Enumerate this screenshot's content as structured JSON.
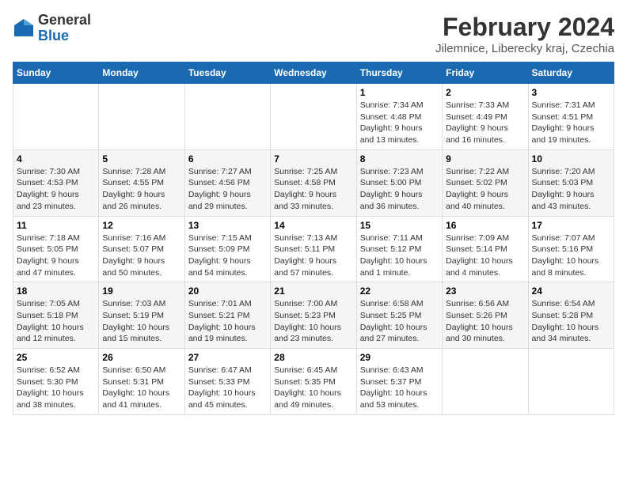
{
  "header": {
    "logo_general": "General",
    "logo_blue": "Blue",
    "title": "February 2024",
    "subtitle": "Jilemnice, Liberecky kraj, Czechia"
  },
  "calendar": {
    "weekdays": [
      "Sunday",
      "Monday",
      "Tuesday",
      "Wednesday",
      "Thursday",
      "Friday",
      "Saturday"
    ],
    "weeks": [
      [
        {
          "day": "",
          "info": ""
        },
        {
          "day": "",
          "info": ""
        },
        {
          "day": "",
          "info": ""
        },
        {
          "day": "",
          "info": ""
        },
        {
          "day": "1",
          "info": "Sunrise: 7:34 AM\nSunset: 4:48 PM\nDaylight: 9 hours\nand 13 minutes."
        },
        {
          "day": "2",
          "info": "Sunrise: 7:33 AM\nSunset: 4:49 PM\nDaylight: 9 hours\nand 16 minutes."
        },
        {
          "day": "3",
          "info": "Sunrise: 7:31 AM\nSunset: 4:51 PM\nDaylight: 9 hours\nand 19 minutes."
        }
      ],
      [
        {
          "day": "4",
          "info": "Sunrise: 7:30 AM\nSunset: 4:53 PM\nDaylight: 9 hours\nand 23 minutes."
        },
        {
          "day": "5",
          "info": "Sunrise: 7:28 AM\nSunset: 4:55 PM\nDaylight: 9 hours\nand 26 minutes."
        },
        {
          "day": "6",
          "info": "Sunrise: 7:27 AM\nSunset: 4:56 PM\nDaylight: 9 hours\nand 29 minutes."
        },
        {
          "day": "7",
          "info": "Sunrise: 7:25 AM\nSunset: 4:58 PM\nDaylight: 9 hours\nand 33 minutes."
        },
        {
          "day": "8",
          "info": "Sunrise: 7:23 AM\nSunset: 5:00 PM\nDaylight: 9 hours\nand 36 minutes."
        },
        {
          "day": "9",
          "info": "Sunrise: 7:22 AM\nSunset: 5:02 PM\nDaylight: 9 hours\nand 40 minutes."
        },
        {
          "day": "10",
          "info": "Sunrise: 7:20 AM\nSunset: 5:03 PM\nDaylight: 9 hours\nand 43 minutes."
        }
      ],
      [
        {
          "day": "11",
          "info": "Sunrise: 7:18 AM\nSunset: 5:05 PM\nDaylight: 9 hours\nand 47 minutes."
        },
        {
          "day": "12",
          "info": "Sunrise: 7:16 AM\nSunset: 5:07 PM\nDaylight: 9 hours\nand 50 minutes."
        },
        {
          "day": "13",
          "info": "Sunrise: 7:15 AM\nSunset: 5:09 PM\nDaylight: 9 hours\nand 54 minutes."
        },
        {
          "day": "14",
          "info": "Sunrise: 7:13 AM\nSunset: 5:11 PM\nDaylight: 9 hours\nand 57 minutes."
        },
        {
          "day": "15",
          "info": "Sunrise: 7:11 AM\nSunset: 5:12 PM\nDaylight: 10 hours\nand 1 minute."
        },
        {
          "day": "16",
          "info": "Sunrise: 7:09 AM\nSunset: 5:14 PM\nDaylight: 10 hours\nand 4 minutes."
        },
        {
          "day": "17",
          "info": "Sunrise: 7:07 AM\nSunset: 5:16 PM\nDaylight: 10 hours\nand 8 minutes."
        }
      ],
      [
        {
          "day": "18",
          "info": "Sunrise: 7:05 AM\nSunset: 5:18 PM\nDaylight: 10 hours\nand 12 minutes."
        },
        {
          "day": "19",
          "info": "Sunrise: 7:03 AM\nSunset: 5:19 PM\nDaylight: 10 hours\nand 15 minutes."
        },
        {
          "day": "20",
          "info": "Sunrise: 7:01 AM\nSunset: 5:21 PM\nDaylight: 10 hours\nand 19 minutes."
        },
        {
          "day": "21",
          "info": "Sunrise: 7:00 AM\nSunset: 5:23 PM\nDaylight: 10 hours\nand 23 minutes."
        },
        {
          "day": "22",
          "info": "Sunrise: 6:58 AM\nSunset: 5:25 PM\nDaylight: 10 hours\nand 27 minutes."
        },
        {
          "day": "23",
          "info": "Sunrise: 6:56 AM\nSunset: 5:26 PM\nDaylight: 10 hours\nand 30 minutes."
        },
        {
          "day": "24",
          "info": "Sunrise: 6:54 AM\nSunset: 5:28 PM\nDaylight: 10 hours\nand 34 minutes."
        }
      ],
      [
        {
          "day": "25",
          "info": "Sunrise: 6:52 AM\nSunset: 5:30 PM\nDaylight: 10 hours\nand 38 minutes."
        },
        {
          "day": "26",
          "info": "Sunrise: 6:50 AM\nSunset: 5:31 PM\nDaylight: 10 hours\nand 41 minutes."
        },
        {
          "day": "27",
          "info": "Sunrise: 6:47 AM\nSunset: 5:33 PM\nDaylight: 10 hours\nand 45 minutes."
        },
        {
          "day": "28",
          "info": "Sunrise: 6:45 AM\nSunset: 5:35 PM\nDaylight: 10 hours\nand 49 minutes."
        },
        {
          "day": "29",
          "info": "Sunrise: 6:43 AM\nSunset: 5:37 PM\nDaylight: 10 hours\nand 53 minutes."
        },
        {
          "day": "",
          "info": ""
        },
        {
          "day": "",
          "info": ""
        }
      ]
    ]
  }
}
